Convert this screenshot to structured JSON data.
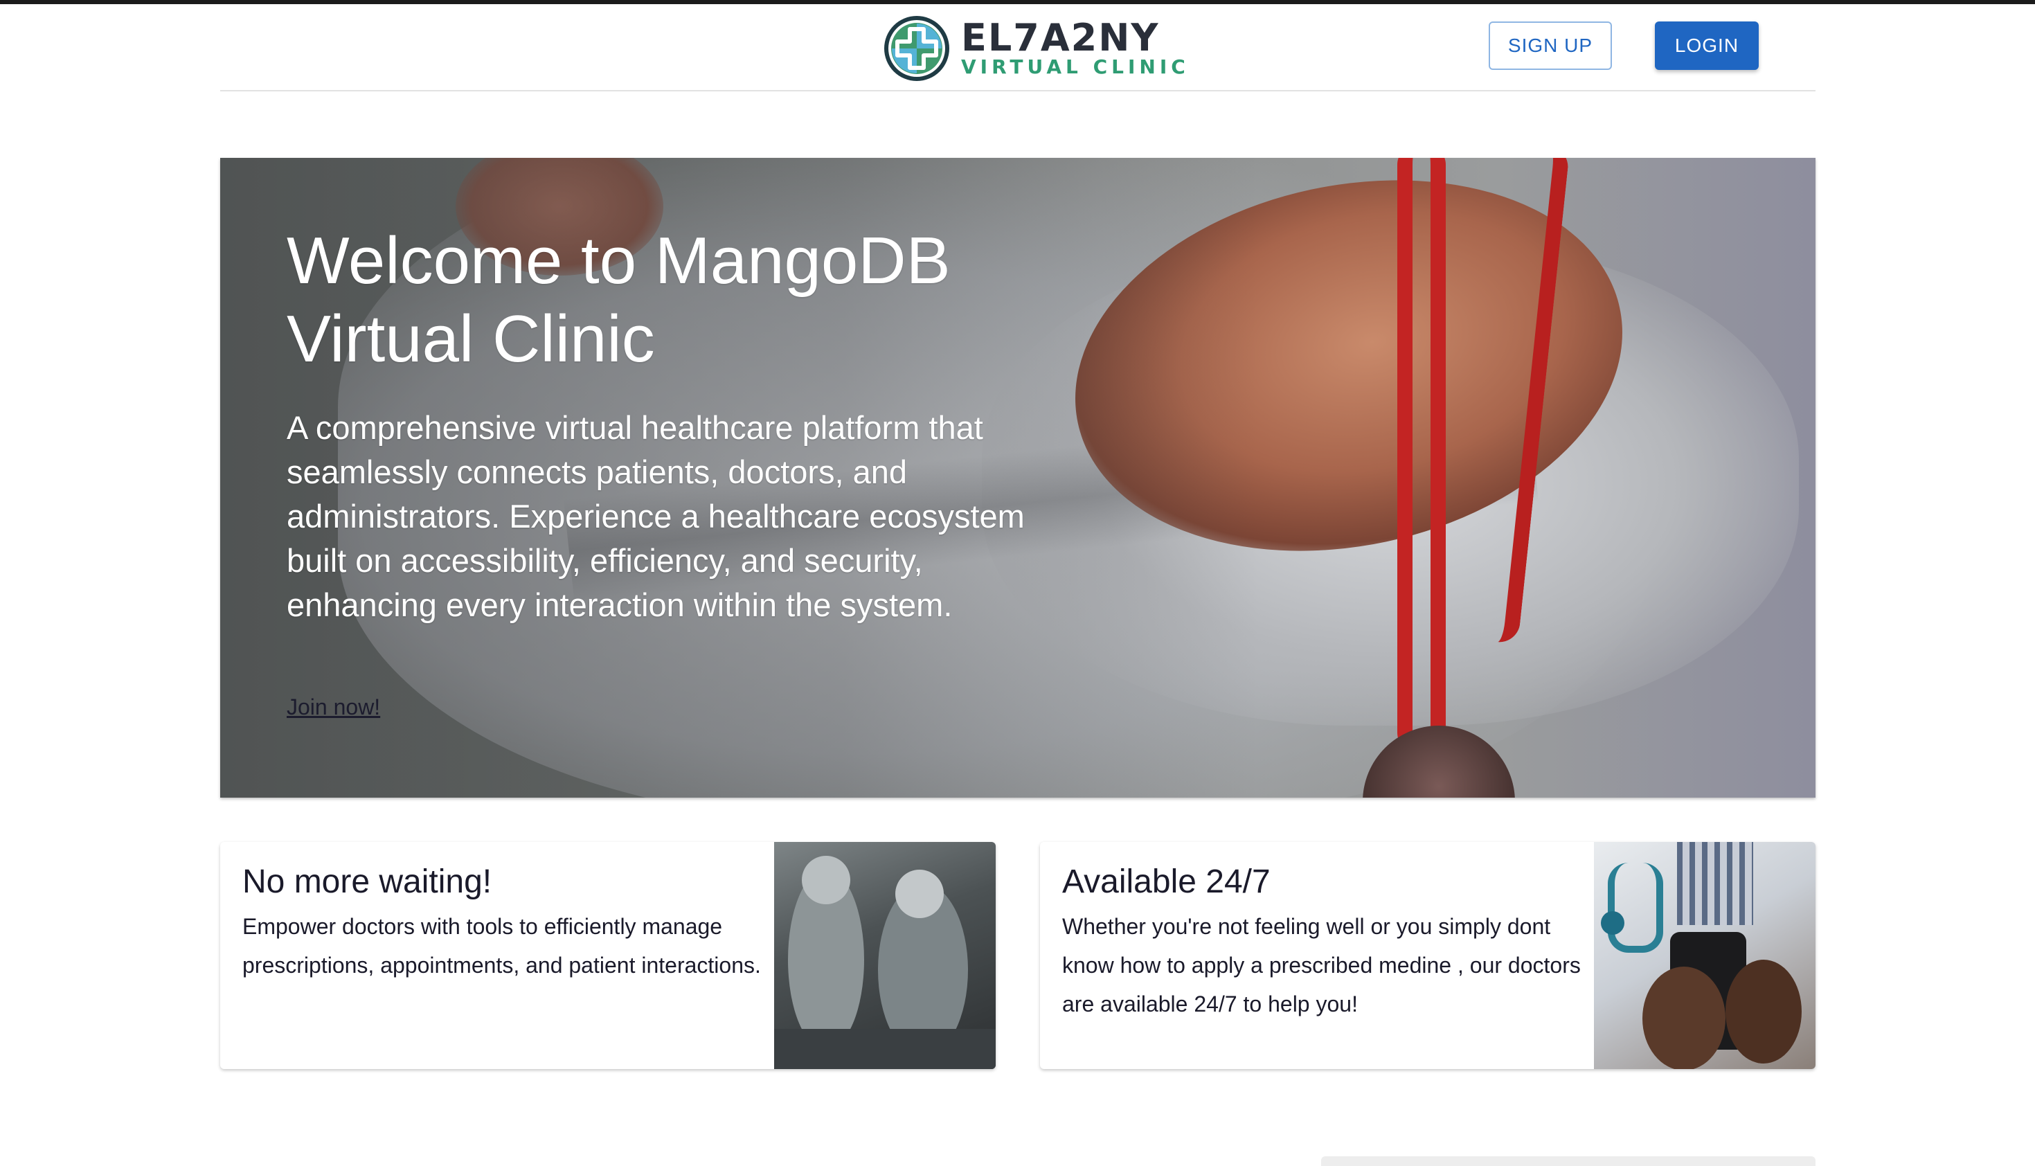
{
  "header": {
    "logo": {
      "name": "EL7A2NY",
      "subtitle": "VIRTUAL CLINIC"
    },
    "signup_label": "SIGN UP",
    "login_label": "LOGIN"
  },
  "hero": {
    "title_line1": "Welcome to MangoDB",
    "title_line2": "Virtual Clinic",
    "description": "A comprehensive virtual healthcare platform that seamlessly connects patients, doctors, and administrators. Experience a healthcare ecosystem built on accessibility, efficiency, and security, enhancing every interaction within the system.",
    "link_label": "Join now!"
  },
  "cards": [
    {
      "title": "No more waiting!",
      "text": "Empower doctors with tools to efficiently manage prescriptions, appointments, and patient interactions."
    },
    {
      "title": "Available 24/7",
      "text": "Whether you're not feeling well or you simply dont know how to apply a prescribed medine , our doctors are available 24/7 to help you!"
    }
  ],
  "colors": {
    "primary": "#1f66c2",
    "logo_green": "#2f9c73",
    "logo_dark": "#2a2f3a"
  }
}
